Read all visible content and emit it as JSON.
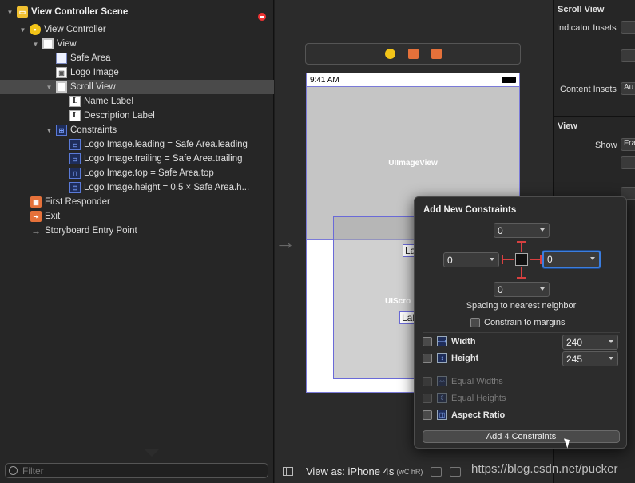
{
  "outline": {
    "rows": [
      {
        "label": "View Controller Scene"
      },
      {
        "label": "View Controller"
      },
      {
        "label": "View"
      },
      {
        "label": "Safe Area"
      },
      {
        "label": "Logo Image"
      },
      {
        "label": "Scroll View"
      },
      {
        "label": "Name Label"
      },
      {
        "label": "Description Label"
      },
      {
        "label": "Constraints"
      },
      {
        "label": "Logo Image.leading = Safe Area.leading"
      },
      {
        "label": "Logo Image.trailing = Safe Area.trailing"
      },
      {
        "label": "Logo Image.top = Safe Area.top"
      },
      {
        "label": "Logo Image.height = 0.5 × Safe Area.h..."
      },
      {
        "label": "First Responder"
      },
      {
        "label": "Exit"
      },
      {
        "label": "Storyboard Entry Point"
      }
    ],
    "filter_placeholder": "Filter"
  },
  "canvas": {
    "status_time": "9:41 AM",
    "image_view_label": "UIImageView",
    "scroll_view_label": "UIScro",
    "label_1": "Lab",
    "label_2": "Lab",
    "view_as": "View as: iPhone 4s",
    "view_as_traits": "(wC hR)"
  },
  "inspector": {
    "section_scroll_view": "Scroll View",
    "indicator_insets": "Indicator Insets",
    "content_insets": "Content Insets",
    "content_insets_value": "Au",
    "section_view": "View",
    "show": "Show",
    "show_value": "Fra"
  },
  "popover": {
    "title": "Add New Constraints",
    "top_value": "0",
    "left_value": "0",
    "right_value": "0",
    "bottom_value": "0",
    "spacing_caption": "Spacing to nearest neighbor",
    "constrain_to_margins": "Constrain to margins",
    "width_label": "Width",
    "width_value": "240",
    "height_label": "Height",
    "height_value": "245",
    "equal_widths": "Equal Widths",
    "equal_heights": "Equal Heights",
    "aspect_ratio": "Aspect Ratio",
    "add_button": "Add 4 Constraints"
  },
  "watermark": "https://blog.csdn.net/pucker",
  "colors": {
    "selection": "#4a4a4a",
    "focus_ring": "#3b7ee0",
    "strut_red": "#d84040",
    "canvas_bg": "#2b2b2b"
  }
}
